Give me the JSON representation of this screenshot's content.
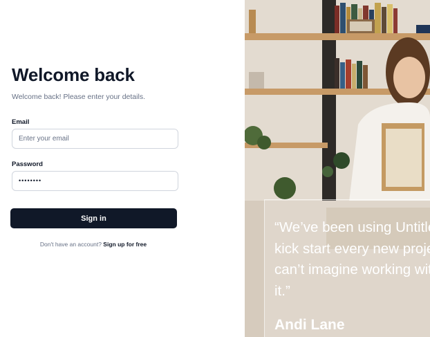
{
  "form": {
    "title": "Welcome back",
    "subtitle": "Welcome back! Please enter your details.",
    "email_label": "Email",
    "email_placeholder": "Enter your email",
    "password_label": "Password",
    "password_value": "••••••••",
    "signin_label": "Sign in",
    "no_account_text": "Don't have an account?",
    "signup_link": "Sign up for free"
  },
  "testimonial": {
    "quote": "“We’ve been using Untitled to\nkick start every new project and\ncan’t imagine working without\nit.”",
    "author": "Andi Lane"
  },
  "colors": {
    "primary": "#101828",
    "muted_text": "#667085",
    "border": "#d0d5dd"
  }
}
